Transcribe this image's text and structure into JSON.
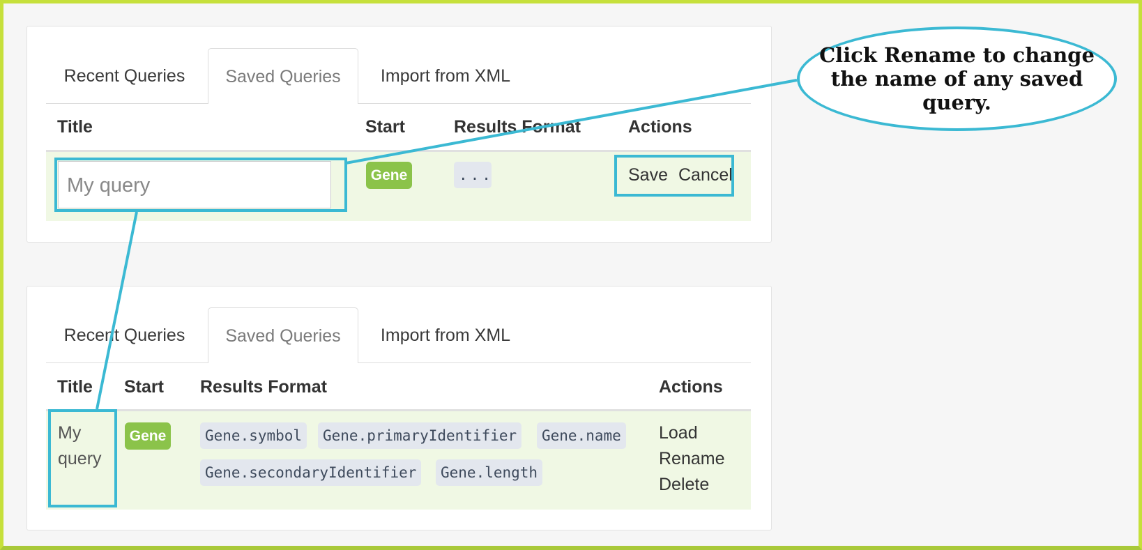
{
  "callout": {
    "text": "Click Rename to change the name of any saved query."
  },
  "top_panel": {
    "tabs": [
      "Recent Queries",
      "Saved Queries",
      "Import from XML"
    ],
    "active_tab": "Saved Queries",
    "columns": [
      "Title",
      "Start",
      "Results Format",
      "Actions"
    ],
    "row": {
      "title_input_placeholder": "My query",
      "start_badge": "Gene",
      "format_placeholder": "...",
      "actions": {
        "save": "Save",
        "cancel": "Cancel"
      }
    }
  },
  "bottom_panel": {
    "tabs": [
      "Recent Queries",
      "Saved Queries",
      "Import from XML"
    ],
    "active_tab": "Saved Queries",
    "columns": [
      "Title",
      "Start",
      "Results Format",
      "Actions"
    ],
    "row": {
      "title_line1": "My",
      "title_line2": "query",
      "start_badge": "Gene",
      "format_fields": [
        "Gene.symbol",
        "Gene.primaryIdentifier",
        "Gene.name",
        "Gene.secondaryIdentifier",
        "Gene.length"
      ],
      "actions": [
        "Load",
        "Rename",
        "Delete"
      ]
    }
  },
  "colors": {
    "highlight": "#3bb9d3",
    "badge_green": "#8bc34a",
    "row_green": "#f0f8e4",
    "frame": "#c6e03b"
  }
}
